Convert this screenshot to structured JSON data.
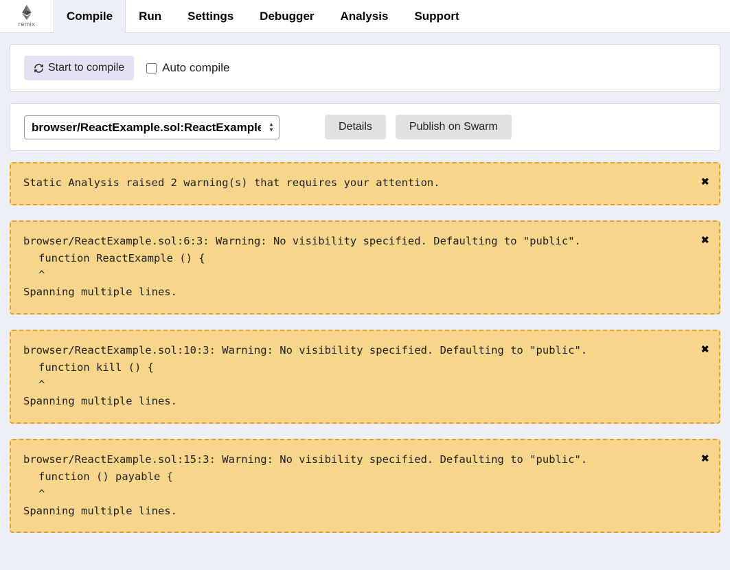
{
  "logo": {
    "text": "remix"
  },
  "tabs": [
    {
      "label": "Compile",
      "active": true
    },
    {
      "label": "Run",
      "active": false
    },
    {
      "label": "Settings",
      "active": false
    },
    {
      "label": "Debugger",
      "active": false
    },
    {
      "label": "Analysis",
      "active": false
    },
    {
      "label": "Support",
      "active": false
    }
  ],
  "compile_panel": {
    "button_label": "Start to compile",
    "auto_compile_label": "Auto compile",
    "auto_compile_checked": false
  },
  "contract_panel": {
    "selected": "browser/ReactExample.sol:ReactExample",
    "details_label": "Details",
    "publish_label": "Publish on Swarm"
  },
  "warnings": [
    {
      "summary": "Static Analysis raised 2 warning(s) that requires your attention."
    },
    {
      "header": "browser/ReactExample.sol:6:3: Warning: No visibility specified. Defaulting to \"public\".",
      "code": "function ReactExample () {",
      "caret": "^",
      "footer": "Spanning multiple lines."
    },
    {
      "header": "browser/ReactExample.sol:10:3: Warning: No visibility specified. Defaulting to \"public\".",
      "code": "function kill () {",
      "caret": "^",
      "footer": "Spanning multiple lines."
    },
    {
      "header": "browser/ReactExample.sol:15:3: Warning: No visibility specified. Defaulting to \"public\".",
      "code": "function () payable {",
      "caret": "^",
      "footer": "Spanning multiple lines."
    }
  ]
}
